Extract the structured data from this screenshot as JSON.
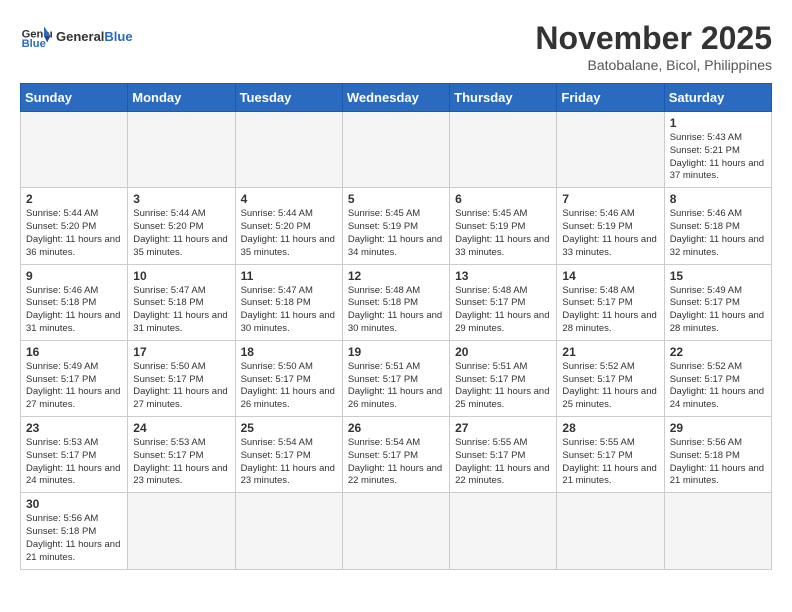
{
  "header": {
    "logo_general": "General",
    "logo_blue": "Blue",
    "month_title": "November 2025",
    "subtitle": "Batobalane, Bicol, Philippines"
  },
  "weekdays": [
    "Sunday",
    "Monday",
    "Tuesday",
    "Wednesday",
    "Thursday",
    "Friday",
    "Saturday"
  ],
  "days": [
    {
      "num": "",
      "info": ""
    },
    {
      "num": "",
      "info": ""
    },
    {
      "num": "",
      "info": ""
    },
    {
      "num": "",
      "info": ""
    },
    {
      "num": "",
      "info": ""
    },
    {
      "num": "",
      "info": ""
    },
    {
      "num": "1",
      "sunrise": "5:43 AM",
      "sunset": "5:21 PM",
      "daylight": "11 hours and 37 minutes."
    },
    {
      "num": "2",
      "sunrise": "5:44 AM",
      "sunset": "5:20 PM",
      "daylight": "11 hours and 36 minutes."
    },
    {
      "num": "3",
      "sunrise": "5:44 AM",
      "sunset": "5:20 PM",
      "daylight": "11 hours and 35 minutes."
    },
    {
      "num": "4",
      "sunrise": "5:44 AM",
      "sunset": "5:20 PM",
      "daylight": "11 hours and 35 minutes."
    },
    {
      "num": "5",
      "sunrise": "5:45 AM",
      "sunset": "5:19 PM",
      "daylight": "11 hours and 34 minutes."
    },
    {
      "num": "6",
      "sunrise": "5:45 AM",
      "sunset": "5:19 PM",
      "daylight": "11 hours and 33 minutes."
    },
    {
      "num": "7",
      "sunrise": "5:46 AM",
      "sunset": "5:19 PM",
      "daylight": "11 hours and 33 minutes."
    },
    {
      "num": "8",
      "sunrise": "5:46 AM",
      "sunset": "5:18 PM",
      "daylight": "11 hours and 32 minutes."
    },
    {
      "num": "9",
      "sunrise": "5:46 AM",
      "sunset": "5:18 PM",
      "daylight": "11 hours and 31 minutes."
    },
    {
      "num": "10",
      "sunrise": "5:47 AM",
      "sunset": "5:18 PM",
      "daylight": "11 hours and 31 minutes."
    },
    {
      "num": "11",
      "sunrise": "5:47 AM",
      "sunset": "5:18 PM",
      "daylight": "11 hours and 30 minutes."
    },
    {
      "num": "12",
      "sunrise": "5:48 AM",
      "sunset": "5:18 PM",
      "daylight": "11 hours and 30 minutes."
    },
    {
      "num": "13",
      "sunrise": "5:48 AM",
      "sunset": "5:17 PM",
      "daylight": "11 hours and 29 minutes."
    },
    {
      "num": "14",
      "sunrise": "5:48 AM",
      "sunset": "5:17 PM",
      "daylight": "11 hours and 28 minutes."
    },
    {
      "num": "15",
      "sunrise": "5:49 AM",
      "sunset": "5:17 PM",
      "daylight": "11 hours and 28 minutes."
    },
    {
      "num": "16",
      "sunrise": "5:49 AM",
      "sunset": "5:17 PM",
      "daylight": "11 hours and 27 minutes."
    },
    {
      "num": "17",
      "sunrise": "5:50 AM",
      "sunset": "5:17 PM",
      "daylight": "11 hours and 27 minutes."
    },
    {
      "num": "18",
      "sunrise": "5:50 AM",
      "sunset": "5:17 PM",
      "daylight": "11 hours and 26 minutes."
    },
    {
      "num": "19",
      "sunrise": "5:51 AM",
      "sunset": "5:17 PM",
      "daylight": "11 hours and 26 minutes."
    },
    {
      "num": "20",
      "sunrise": "5:51 AM",
      "sunset": "5:17 PM",
      "daylight": "11 hours and 25 minutes."
    },
    {
      "num": "21",
      "sunrise": "5:52 AM",
      "sunset": "5:17 PM",
      "daylight": "11 hours and 25 minutes."
    },
    {
      "num": "22",
      "sunrise": "5:52 AM",
      "sunset": "5:17 PM",
      "daylight": "11 hours and 24 minutes."
    },
    {
      "num": "23",
      "sunrise": "5:53 AM",
      "sunset": "5:17 PM",
      "daylight": "11 hours and 24 minutes."
    },
    {
      "num": "24",
      "sunrise": "5:53 AM",
      "sunset": "5:17 PM",
      "daylight": "11 hours and 23 minutes."
    },
    {
      "num": "25",
      "sunrise": "5:54 AM",
      "sunset": "5:17 PM",
      "daylight": "11 hours and 23 minutes."
    },
    {
      "num": "26",
      "sunrise": "5:54 AM",
      "sunset": "5:17 PM",
      "daylight": "11 hours and 22 minutes."
    },
    {
      "num": "27",
      "sunrise": "5:55 AM",
      "sunset": "5:17 PM",
      "daylight": "11 hours and 22 minutes."
    },
    {
      "num": "28",
      "sunrise": "5:55 AM",
      "sunset": "5:17 PM",
      "daylight": "11 hours and 21 minutes."
    },
    {
      "num": "29",
      "sunrise": "5:56 AM",
      "sunset": "5:18 PM",
      "daylight": "11 hours and 21 minutes."
    },
    {
      "num": "30",
      "sunrise": "5:56 AM",
      "sunset": "5:18 PM",
      "daylight": "11 hours and 21 minutes."
    }
  ]
}
